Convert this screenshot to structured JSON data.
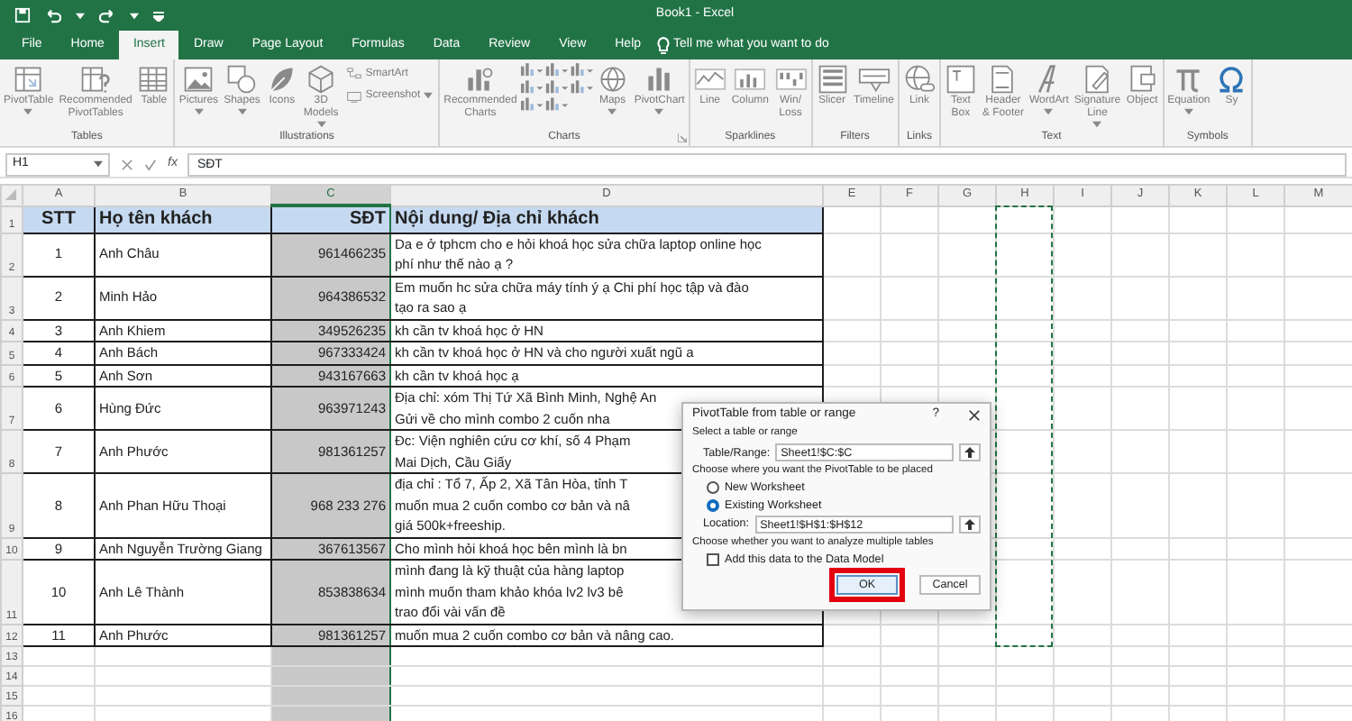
{
  "window": {
    "title": "Book1 - Excel"
  },
  "ribbon_tabs": [
    {
      "label": "File",
      "selected": false
    },
    {
      "label": "Home",
      "selected": false
    },
    {
      "label": "Insert",
      "selected": true
    },
    {
      "label": "Draw",
      "selected": false
    },
    {
      "label": "Page Layout",
      "selected": false
    },
    {
      "label": "Formulas",
      "selected": false
    },
    {
      "label": "Data",
      "selected": false
    },
    {
      "label": "Review",
      "selected": false
    },
    {
      "label": "View",
      "selected": false
    },
    {
      "label": "Help",
      "selected": false
    }
  ],
  "tell_me": "Tell me what you want to do",
  "ribbon_groups": [
    {
      "name": "Tables",
      "commands": [
        {
          "kind": "large",
          "label": "PivotTable",
          "dropdown": true
        },
        {
          "kind": "large",
          "label": "Recommended\nPivotTables"
        },
        {
          "kind": "large",
          "label": "Table"
        }
      ]
    },
    {
      "name": "Illustrations",
      "commands": [
        {
          "kind": "large",
          "label": "Pictures",
          "dropdown": true
        },
        {
          "kind": "large",
          "label": "Shapes",
          "dropdown": true
        },
        {
          "kind": "large",
          "label": "Icons"
        },
        {
          "kind": "large",
          "label": "3D\nModels",
          "dropdown": true
        },
        {
          "kind": "small",
          "label": "SmartArt"
        },
        {
          "kind": "small",
          "label": "Screenshot",
          "dropdown": true
        }
      ]
    },
    {
      "name": "Charts",
      "launcher": true,
      "commands": [
        {
          "kind": "large",
          "label": "Recommended\nCharts"
        },
        {
          "kind": "gallery"
        },
        {
          "kind": "large",
          "label": "Maps",
          "dropdown": true
        },
        {
          "kind": "large",
          "label": "PivotChart",
          "dropdown": true
        }
      ]
    },
    {
      "name": "Sparklines",
      "commands": [
        {
          "kind": "large",
          "label": "Line"
        },
        {
          "kind": "large",
          "label": "Column"
        },
        {
          "kind": "large",
          "label": "Win/\nLoss"
        }
      ]
    },
    {
      "name": "Filters",
      "commands": [
        {
          "kind": "large",
          "label": "Slicer"
        },
        {
          "kind": "large",
          "label": "Timeline"
        }
      ]
    },
    {
      "name": "Links",
      "commands": [
        {
          "kind": "large",
          "label": "Link"
        }
      ]
    },
    {
      "name": "Text",
      "commands": [
        {
          "kind": "large",
          "label": "Text\nBox"
        },
        {
          "kind": "large",
          "label": "Header\n& Footer"
        },
        {
          "kind": "large",
          "label": "WordArt",
          "dropdown": true
        },
        {
          "kind": "large",
          "label": "Signature\nLine",
          "dropdown": true
        },
        {
          "kind": "large",
          "label": "Object"
        }
      ]
    },
    {
      "name": "Symbols",
      "commands": [
        {
          "kind": "large",
          "label": "Equation",
          "dropdown": true
        },
        {
          "kind": "large",
          "label": "Sy"
        }
      ]
    }
  ],
  "formula_bar": {
    "name_box": "H1",
    "function_label": "fx",
    "formula": "SĐT"
  },
  "sheet": {
    "columns": [
      {
        "label": "A",
        "selected": false
      },
      {
        "label": "B",
        "selected": false
      },
      {
        "label": "C",
        "selected": true
      },
      {
        "label": "D",
        "selected": false
      },
      {
        "label": "E",
        "selected": false
      },
      {
        "label": "F",
        "selected": false
      },
      {
        "label": "G",
        "selected": false
      },
      {
        "label": "H",
        "selected": false,
        "marquee": true
      },
      {
        "label": "I",
        "selected": false
      },
      {
        "label": "J",
        "selected": false
      },
      {
        "label": "K",
        "selected": false
      },
      {
        "label": "L",
        "selected": false
      },
      {
        "label": "M",
        "selected": false
      }
    ],
    "rows": [
      {
        "number": "1",
        "kind": "header",
        "cells": [
          "STT",
          "Họ tên khách",
          "SĐT",
          "Nội dung/ Địa chỉ khách"
        ]
      },
      {
        "number": "2",
        "kind": "data",
        "cells": [
          "1",
          "Anh Châu",
          "961466235",
          "Da e ở tphcm cho e hỏi khoá học sửa chữa laptop online học\nphí như thế nào ạ ?"
        ]
      },
      {
        "number": "3",
        "kind": "data",
        "cells": [
          "2",
          "Minh Hảo",
          "964386532",
          "Em muốn hc sửa chữa máy tính ý ạ Chi phí học tập và đào\ntạo ra sao ạ"
        ]
      },
      {
        "number": "4",
        "kind": "data",
        "cells": [
          "3",
          "Anh Khiem",
          "349526235",
          "kh cần tv khoá học ở HN"
        ]
      },
      {
        "number": "5",
        "kind": "data",
        "cells": [
          "4",
          "Anh Bách",
          "967333424",
          "kh cần tv khoá học ở HN và cho người xuất ngũ a"
        ]
      },
      {
        "number": "6",
        "kind": "data",
        "cells": [
          "5",
          "Anh Sơn",
          "943167663",
          "kh cần tv khoá học ạ"
        ]
      },
      {
        "number": "7",
        "kind": "data",
        "cells": [
          "6",
          "Hùng Đức",
          "963971243",
          "Địa chỉ: xóm Thị Tứ Xã Bình Minh, Nghệ An\nGửi về cho mình combo 2 cuốn nha"
        ]
      },
      {
        "number": "8",
        "kind": "data",
        "cells": [
          "7",
          "Anh Phước",
          "981361257",
          "Đc: Viện nghiên cứu cơ khí, số 4 Phạm\nMai Dịch, Cầu Giấy"
        ]
      },
      {
        "number": "9",
        "kind": "data",
        "cells": [
          "8",
          "Anh Phan Hữu Thoại",
          "968 233 276",
          "địa chỉ : Tổ 7, Ấp 2, Xã Tân Hòa, tỉnh T\nmuốn mua 2 cuốn combo cơ bản và nâ\ngiá 500k+freeship."
        ]
      },
      {
        "number": "10",
        "kind": "data",
        "cells": [
          "9",
          "Anh Nguyễn Trường Giang",
          "367613567",
          "Cho mình hỏi khoá học bên mình là bn"
        ]
      },
      {
        "number": "11",
        "kind": "data",
        "cells": [
          "10",
          "Anh Lê Thành",
          "853838634",
          "mình đang là kỹ thuật của hàng laptop\nmình muốn tham khảo khóa lv2 lv3 bê\ntrao đổi vài vấn đề"
        ]
      },
      {
        "number": "12",
        "kind": "data",
        "cells": [
          "11",
          "Anh Phước",
          "981361257",
          "muốn mua 2 cuốn combo cơ bản và nâng cao."
        ]
      },
      {
        "number": "13"
      },
      {
        "number": "14"
      },
      {
        "number": "15"
      },
      {
        "number": "16"
      }
    ]
  },
  "dialog": {
    "title": "PivotTable from table or range",
    "help_label": "?",
    "source_heading": "Select a table or range",
    "range_label": "Table/Range:",
    "range_value": "Sheet1!$C:$C",
    "placement_heading": "Choose where you want the PivotTable to be placed",
    "placement_options": [
      {
        "label": "New Worksheet",
        "selected": false
      },
      {
        "label": "Existing Worksheet",
        "selected": true
      }
    ],
    "location_label": "Location:",
    "location_value": "Sheet1!$H$1:$H$12",
    "tables_heading": "Choose whether you want to analyze multiple tables",
    "data_model": {
      "label": "Add this data to the Data Model",
      "checked": false
    },
    "buttons": [
      {
        "label": "OK",
        "default": true,
        "annotated": true
      },
      {
        "label": "Cancel",
        "default": false,
        "annotated": false
      }
    ]
  }
}
